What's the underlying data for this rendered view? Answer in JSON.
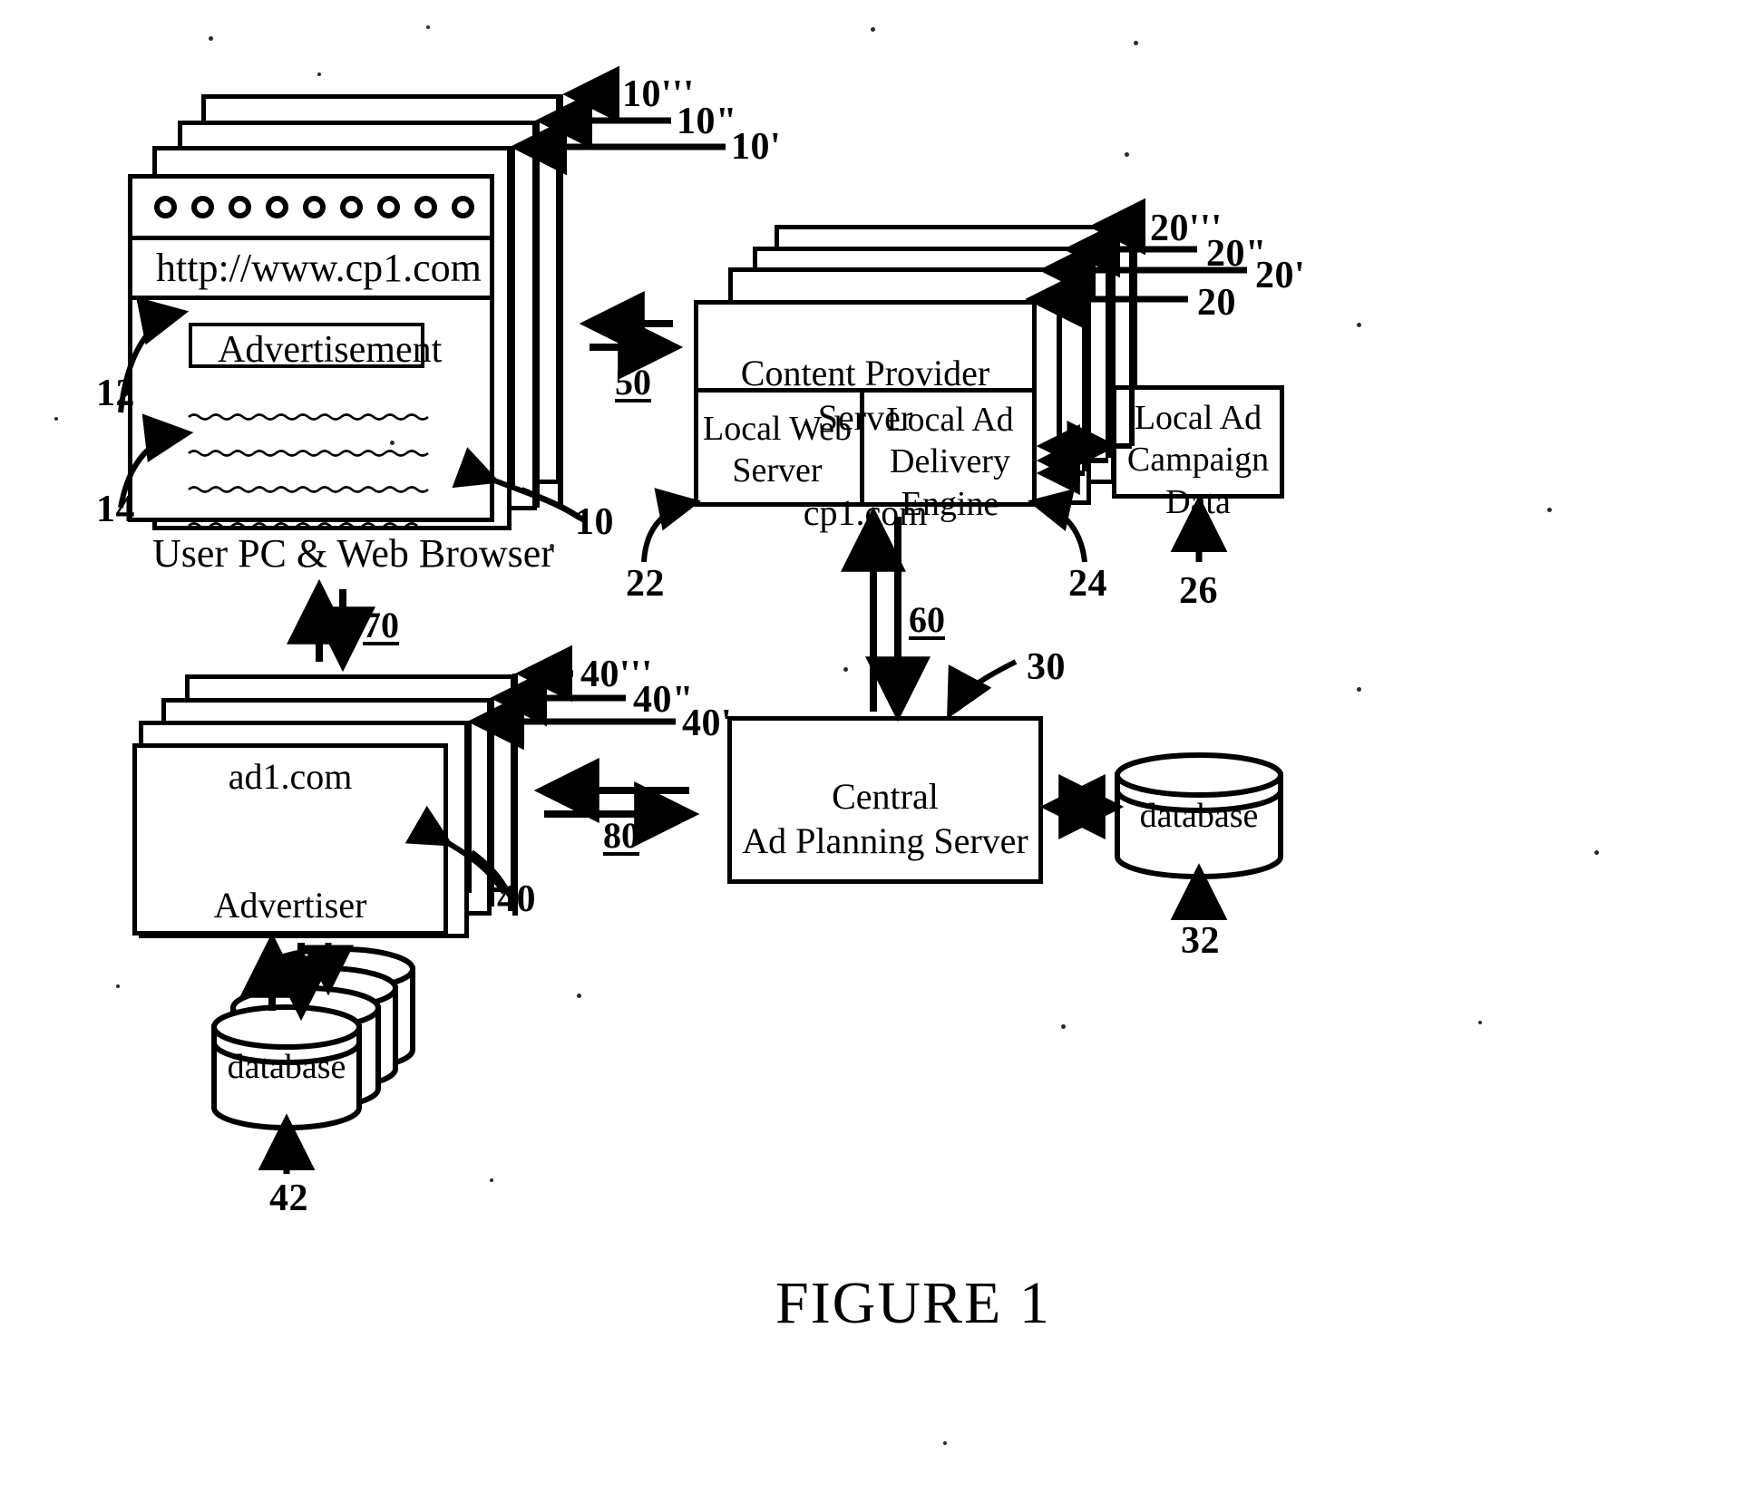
{
  "figure": {
    "title": "FIGURE 1",
    "type": "patent-block-diagram"
  },
  "browser_stack": {
    "url": "http://www.cp1.com",
    "ad_box_label": "Advertisement",
    "caption": "User PC & Web Browser",
    "refs": {
      "stack_top": "10'''",
      "stack_second": "10\"",
      "stack_third": "10'",
      "front": "10",
      "ad_region": "12",
      "content_region": "14"
    },
    "toolbar_button_count": 9,
    "content_line_count": 4
  },
  "content_provider": {
    "title_line1": "Content Provider Server",
    "title_line2": "cp1.com",
    "local_web_server": "Local Web\nServer",
    "local_ad_delivery_engine": "Local Ad\nDelivery\nEngine",
    "refs": {
      "stack_top": "20'''",
      "stack_second": "20\"",
      "stack_third": "20'",
      "front": "20",
      "local_web_server": "22",
      "local_ad_delivery_engine": "24"
    }
  },
  "local_ad_campaign_data": {
    "label": "Local Ad\nCampaign\nData",
    "ref": "26"
  },
  "advertiser_stack": {
    "domain": "ad1.com",
    "label": "Advertiser",
    "database_label": "database",
    "refs": {
      "stack_top": "40'''",
      "stack_second": "40\"",
      "stack_third": "40'",
      "front": "40",
      "database": "42"
    }
  },
  "central_server": {
    "label": "Central\nAd Planning Server",
    "ref": "30",
    "database_label": "database",
    "database_ref": "32"
  },
  "connections": [
    {
      "id": "50",
      "label": "50",
      "from": "browser_stack",
      "to": "content_provider",
      "direction": "bidirectional"
    },
    {
      "id": "60",
      "label": "60",
      "from": "content_provider",
      "to": "central_server",
      "direction": "bidirectional"
    },
    {
      "id": "70",
      "label": "70",
      "from": "browser_stack",
      "to": "advertiser_stack",
      "direction": "bidirectional"
    },
    {
      "id": "80",
      "label": "80",
      "from": "advertiser_stack",
      "to": "central_server",
      "direction": "bidirectional"
    }
  ],
  "colors": {
    "ink": "#000000",
    "paper": "#ffffff"
  }
}
